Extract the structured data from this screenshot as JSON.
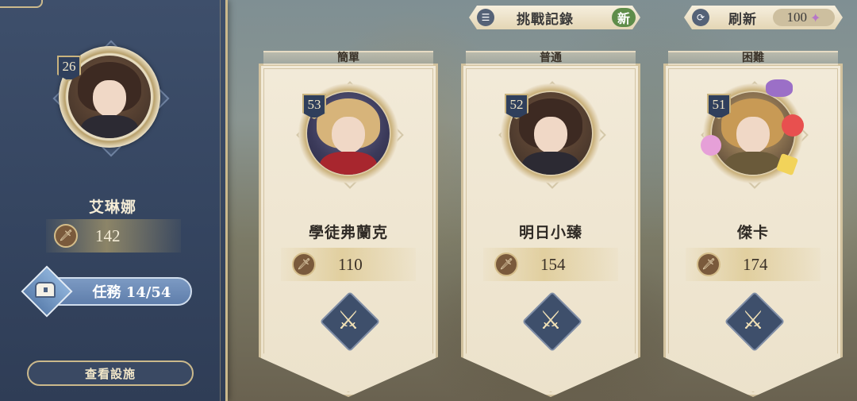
{
  "player": {
    "level": "26",
    "name": "艾琳娜",
    "power": "142",
    "task_label": "任務 14/54",
    "facility_button": "查看設施"
  },
  "top_bar": {
    "record_label": "挑戰記錄",
    "new_badge": "新",
    "refresh_label": "刷新",
    "refresh_cost": "100",
    "cost_icon": "crystal-gem-icon"
  },
  "opponents": [
    {
      "difficulty": "簡單",
      "level": "53",
      "name": "學徒弗蘭克",
      "power": "110",
      "action_icon": "crossed-swords-icon"
    },
    {
      "difficulty": "普通",
      "level": "52",
      "name": "明日小臻",
      "power": "154",
      "action_icon": "crossed-swords-icon"
    },
    {
      "difficulty": "困難",
      "level": "51",
      "name": "傑卡",
      "power": "174",
      "action_icon": "crossed-swords-icon"
    }
  ],
  "colors": {
    "panel": "#3e4f6b",
    "gold_border": "#cbb98c",
    "card_bg": "#f2ead8",
    "task_button": "#6f8cb8",
    "new_badge": "#5f8d4a"
  }
}
